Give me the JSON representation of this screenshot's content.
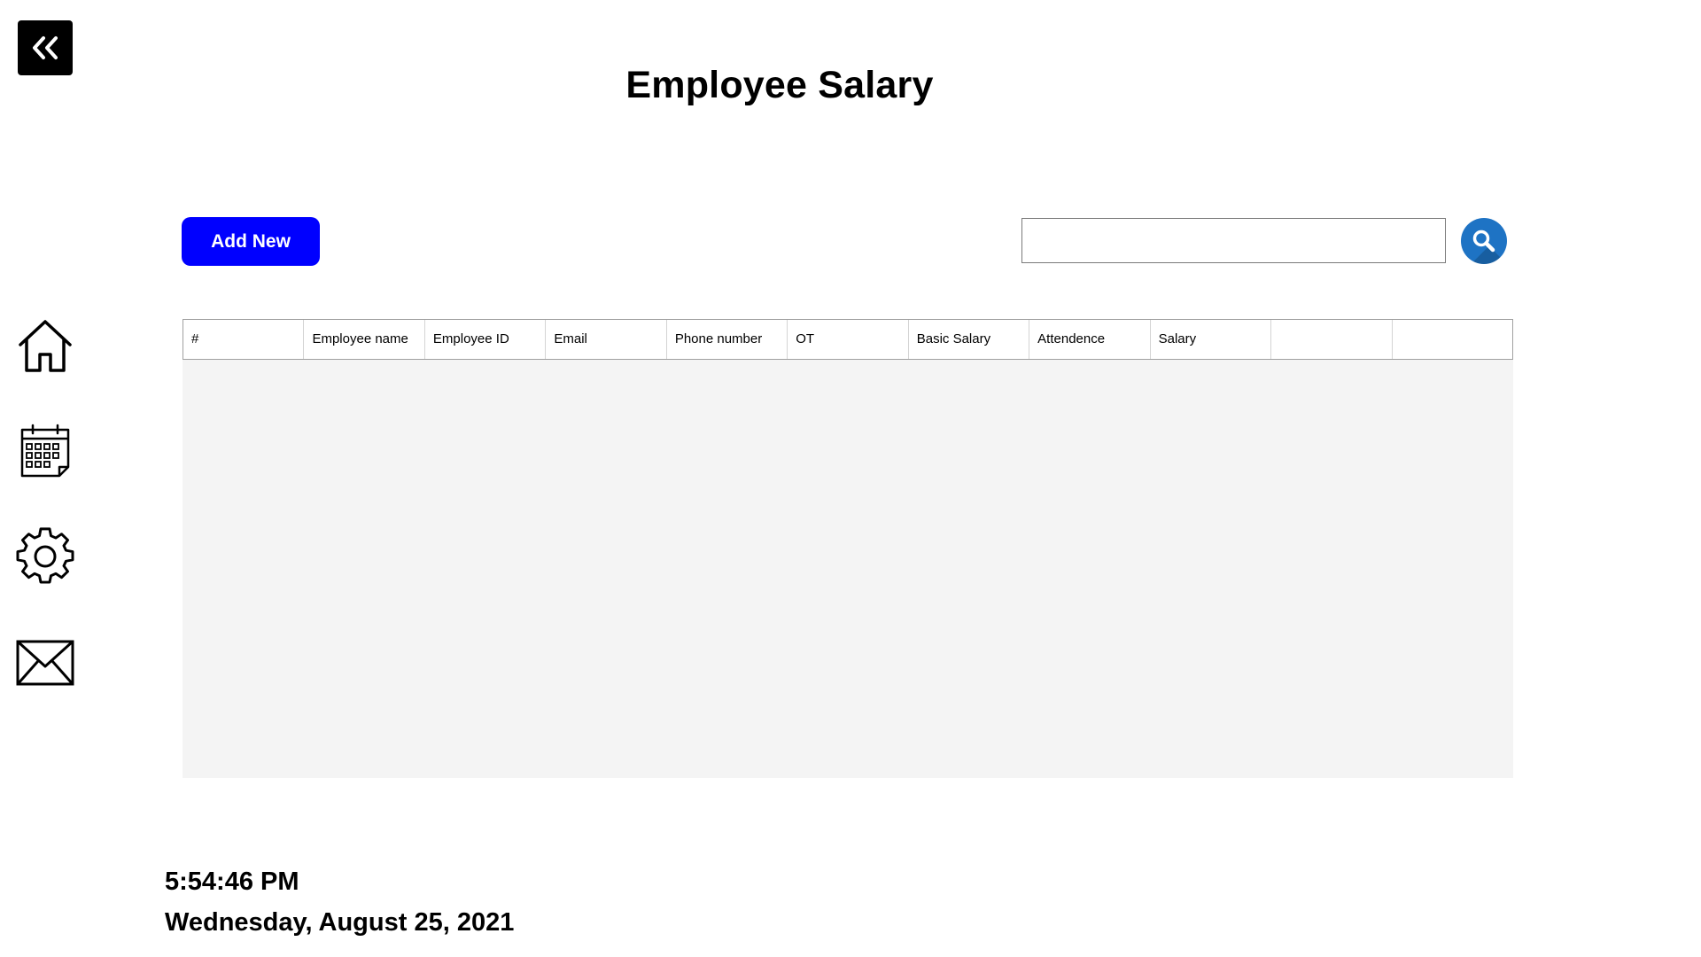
{
  "sidebar": {
    "collapse_icon": "double-chevron-left-icon",
    "items": [
      {
        "icon": "home-icon"
      },
      {
        "icon": "calendar-icon"
      },
      {
        "icon": "gear-icon"
      },
      {
        "icon": "mail-icon"
      }
    ]
  },
  "header": {
    "title": "Employee Salary"
  },
  "toolbar": {
    "add_label": "Add New",
    "search_placeholder": "",
    "search_value": "",
    "search_icon": "search-icon"
  },
  "table": {
    "columns": [
      "#",
      "Employee name",
      "Employee ID",
      "Email",
      "Phone number",
      "OT",
      "Basic Salary",
      "Attendence",
      "Salary",
      "",
      ""
    ],
    "rows": []
  },
  "clock": {
    "time": "5:54:46 PM",
    "date": "Wednesday, August 25, 2021"
  },
  "colors": {
    "accent": "#0000ff",
    "search_button": "#1e73c4",
    "table_body": "#f4f4f4"
  }
}
